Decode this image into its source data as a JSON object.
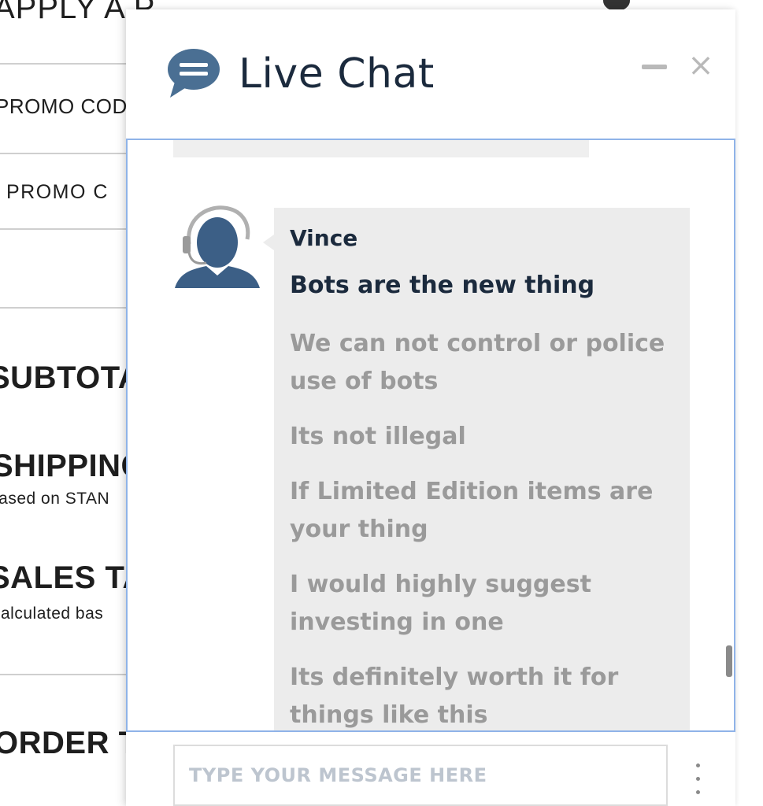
{
  "background_page": {
    "title": "APPLY A PROMO CODE",
    "promo_code_label": "PROMO CODE",
    "promo_code_placeholder": "PROMO C",
    "subtotal_label": "SUBTOTAL",
    "shipping_label": "SHIPPING",
    "shipping_note": "based on STAN",
    "sales_tax_label": "SALES TA",
    "sales_tax_note": "calculated bas",
    "order_total_label": "ORDER T"
  },
  "chat": {
    "title": "Live Chat",
    "icons": {
      "logo": "chat-bubble-icon",
      "minimize": "minimize-icon",
      "close": "close-icon",
      "agent": "agent-headset-avatar",
      "options": "vertical-ellipsis-icon"
    },
    "close_glyph": "×",
    "agent_name": "Vince",
    "messages": [
      {
        "text": "Bots are the new thing",
        "style": "primary"
      },
      {
        "text": "We can not control or police use of bots",
        "style": "secondary"
      },
      {
        "text": "Its not illegal",
        "style": "secondary"
      },
      {
        "text": "If Limited Edition items are your thing",
        "style": "secondary"
      },
      {
        "text": "I would highly suggest investing in one",
        "style": "secondary"
      },
      {
        "text": "Its definitely worth it for things like this",
        "style": "secondary"
      }
    ],
    "input_placeholder": "TYPE YOUR MESSAGE HERE",
    "colors": {
      "header_text": "#1b2a3d",
      "logo": "#4a6f93",
      "body_border": "#8fb3e8",
      "bubble_bg": "#ececec",
      "secondary_text": "#9a9a9a"
    }
  }
}
